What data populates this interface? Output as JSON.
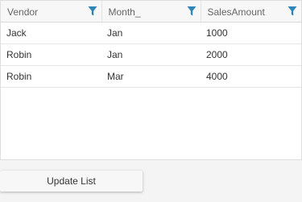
{
  "table": {
    "columns": [
      "Vendor",
      "Month_",
      "SalesAmount"
    ],
    "rows": [
      [
        "Jack",
        "Jan",
        "1000"
      ],
      [
        "Robin",
        "Jan",
        "2000"
      ],
      [
        "Robin",
        "Mar",
        "4000"
      ]
    ],
    "filter_icon_color": "#2c87b8"
  },
  "update_button": {
    "label": "Update List"
  }
}
